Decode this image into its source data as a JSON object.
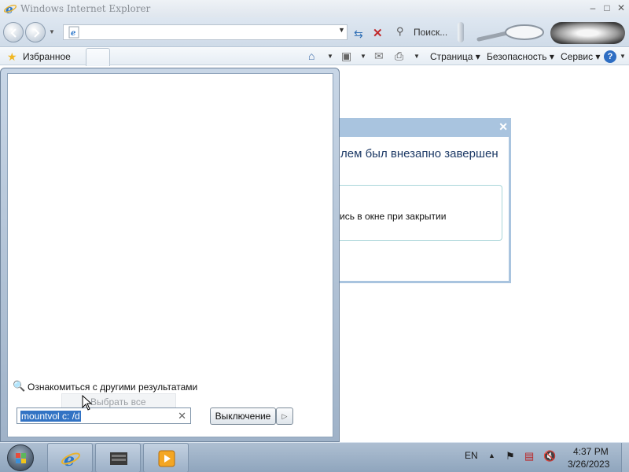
{
  "window": {
    "title": "Windows Internet Explorer",
    "controls": {
      "minimize": "–",
      "maximize": "□",
      "close": "✕"
    }
  },
  "addressbar": {
    "url": "",
    "search_placeholder": "Поиск..."
  },
  "commandbar": {
    "favorites": "Избранное",
    "page": "Страница",
    "safety": "Безопасность",
    "tools": "Сервис",
    "help": "?"
  },
  "dialog": {
    "message": "лем был внезапно завершен",
    "option": "ись в окне при закрытии"
  },
  "startmenu": {
    "more_results": "Ознакомиться с другими результатами",
    "tooltip": "Выбрать все",
    "search_value": "mountvol c: /d",
    "shutdown": "Выключение"
  },
  "taskbar": {
    "lang": "EN",
    "time": "4:37 PM",
    "date": "3/26/2023"
  },
  "colors": {
    "accent": "#3273c4",
    "dialog_border": "#a9c4df"
  }
}
